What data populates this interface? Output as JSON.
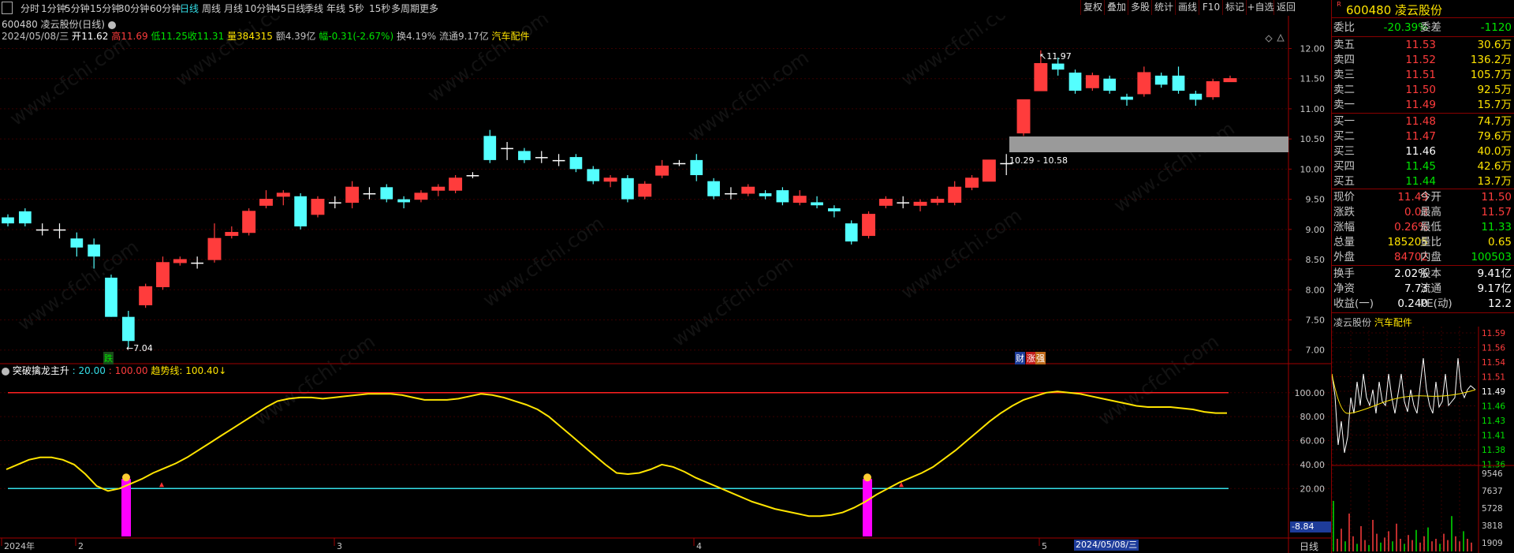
{
  "periods": [
    "分时",
    "1分钟",
    "5分钟",
    "15分钟",
    "30分钟",
    "60分钟",
    "日线",
    "周线",
    "月线",
    "10分钟",
    "45日线",
    "季线",
    "年线",
    "5秒",
    "15秒",
    "多周期",
    "更多"
  ],
  "active_period": "日线",
  "tools": [
    "复权",
    "叠加",
    "多股",
    "统计",
    "画线",
    "F10",
    "标记",
    "+自选",
    "返回"
  ],
  "chart_title": "600480 凌云股份(日线)",
  "info": {
    "date": "2024/05/08/三",
    "open_label": "开",
    "open": "11.62",
    "high_label": "高",
    "high": "11.69",
    "low_label": "低",
    "low": "11.25",
    "close_label": "收",
    "close": "11.31",
    "vol_label": "量",
    "vol": "384315",
    "amt_label": "额",
    "amt": "4.39亿",
    "chg_label": "幅",
    "chg": "-0.31(-2.67%)",
    "turn_label": "换",
    "turn": "4.19%",
    "float_label": "流通",
    "float": "9.17亿",
    "sector": "汽车配件"
  },
  "price_axis": [
    "12.00",
    "11.50",
    "11.00",
    "10.50",
    "10.00",
    "9.50",
    "9.00",
    "8.50",
    "8.00",
    "7.50",
    "7.00"
  ],
  "annotations": {
    "high_mark": "11.97",
    "low_mark": "7.04",
    "range_box": "10.29 - 10.58",
    "mark_die": "跌",
    "mark_cai": "财",
    "mark_zhang": "涨",
    "mark_qiang": "强"
  },
  "indicator": {
    "name": "突破擒龙主升",
    "p1": "20.00",
    "p2": "100.00",
    "trend_label": "趋势线:",
    "trend_val": "100.40↓",
    "axis": [
      "100.00",
      "80.00",
      "60.00",
      "40.00",
      "20.00"
    ],
    "cursor_val": "-8.84"
  },
  "date_axis": [
    "2024年",
    "2",
    "3",
    "4",
    "5"
  ],
  "cursor_date": "2024/05/08/三",
  "axis_corner": "日线",
  "panel": {
    "code": "600480",
    "name": "凌云股份",
    "badge": "R",
    "weibi_label": "委比",
    "weibi": "-20.39%",
    "weicha_label": "委差",
    "weicha": "-1120",
    "asks": [
      {
        "label": "卖五",
        "price": "11.53",
        "vol": "30.6万"
      },
      {
        "label": "卖四",
        "price": "11.52",
        "vol": "136.2万"
      },
      {
        "label": "卖三",
        "price": "11.51",
        "vol": "105.7万"
      },
      {
        "label": "卖二",
        "price": "11.50",
        "vol": "92.5万"
      },
      {
        "label": "卖一",
        "price": "11.49",
        "vol": "15.7万"
      }
    ],
    "bids": [
      {
        "label": "买一",
        "price": "11.48",
        "vol": "74.7万"
      },
      {
        "label": "买二",
        "price": "11.47",
        "vol": "79.6万"
      },
      {
        "label": "买三",
        "price": "11.46",
        "vol": "40.0万"
      },
      {
        "label": "买四",
        "price": "11.45",
        "vol": "42.6万"
      },
      {
        "label": "买五",
        "price": "11.44",
        "vol": "13.7万"
      }
    ],
    "stats": [
      {
        "l1": "现价",
        "v1": "11.49",
        "l2": "今开",
        "v2": "11.50"
      },
      {
        "l1": "涨跌",
        "v1": "0.03",
        "l2": "最高",
        "v2": "11.57"
      },
      {
        "l1": "涨幅",
        "v1": "0.26%",
        "l2": "最低",
        "v2": "11.33"
      },
      {
        "l1": "总量",
        "v1": "185205",
        "l2": "量比",
        "v2": "0.65"
      },
      {
        "l1": "外盘",
        "v1": "84702",
        "l2": "内盘",
        "v2": "100503"
      }
    ],
    "stats2": [
      {
        "l1": "换手",
        "v1": "2.02%",
        "l2": "股本",
        "v2": "9.41亿"
      },
      {
        "l1": "净资",
        "v1": "7.73",
        "l2": "流通",
        "v2": "9.17亿"
      },
      {
        "l1": "收益(一)",
        "v1": "0.240",
        "l2": "PE(动)",
        "v2": "12.2"
      }
    ],
    "mini_title": "凌云股份",
    "mini_sector": "汽车配件",
    "mini_axis": [
      "11.59",
      "11.56",
      "11.54",
      "11.51",
      "11.49",
      "11.46",
      "11.43",
      "11.41",
      "11.38",
      "11.36"
    ],
    "mini_vol_axis": [
      "9546",
      "7637",
      "5728",
      "3818",
      "1909"
    ]
  },
  "watermark": "www.cfchi.com",
  "chart_data": [
    {
      "type": "candlestick",
      "title": "600480 凌云股份(日线)",
      "ylim": [
        6.8,
        12.15
      ],
      "candles": [
        [
          9.2,
          9.1,
          9.25,
          9.05
        ],
        [
          9.3,
          9.1,
          9.35,
          9.05
        ],
        [
          9.0,
          9.0,
          9.1,
          8.9
        ],
        [
          9.0,
          9.0,
          9.1,
          8.85
        ],
        [
          8.85,
          8.7,
          8.95,
          8.55
        ],
        [
          8.75,
          8.55,
          8.85,
          8.35
        ],
        [
          8.2,
          7.55,
          8.25,
          7.55
        ],
        [
          7.55,
          7.15,
          7.65,
          7.04
        ],
        [
          7.75,
          8.05,
          8.1,
          7.7
        ],
        [
          8.05,
          8.45,
          8.55,
          8.0
        ],
        [
          8.45,
          8.5,
          8.55,
          8.4
        ],
        [
          8.45,
          8.45,
          8.55,
          8.35
        ],
        [
          8.5,
          8.85,
          9.1,
          8.45
        ],
        [
          8.9,
          8.95,
          9.05,
          8.85
        ],
        [
          8.95,
          9.3,
          9.35,
          8.9
        ],
        [
          9.4,
          9.5,
          9.65,
          9.35
        ],
        [
          9.55,
          9.6,
          9.65,
          9.4
        ],
        [
          9.55,
          9.05,
          9.6,
          9.0
        ],
        [
          9.25,
          9.5,
          9.55,
          9.2
        ],
        [
          9.45,
          9.45,
          9.55,
          9.35
        ],
        [
          9.45,
          9.7,
          9.8,
          9.35
        ],
        [
          9.6,
          9.6,
          9.7,
          9.5
        ],
        [
          9.7,
          9.5,
          9.75,
          9.45
        ],
        [
          9.5,
          9.45,
          9.55,
          9.35
        ],
        [
          9.5,
          9.6,
          9.65,
          9.45
        ],
        [
          9.65,
          9.7,
          9.75,
          9.55
        ],
        [
          9.65,
          9.85,
          9.9,
          9.6
        ],
        [
          9.9,
          9.9,
          9.95,
          9.85
        ],
        [
          10.55,
          10.15,
          10.65,
          10.1
        ],
        [
          10.35,
          10.35,
          10.45,
          10.15
        ],
        [
          10.3,
          10.15,
          10.35,
          10.1
        ],
        [
          10.2,
          10.2,
          10.3,
          10.1
        ],
        [
          10.15,
          10.15,
          10.25,
          10.05
        ],
        [
          10.2,
          10.0,
          10.25,
          9.95
        ],
        [
          10.0,
          9.8,
          10.05,
          9.75
        ],
        [
          9.8,
          9.85,
          9.9,
          9.7
        ],
        [
          9.85,
          9.5,
          9.9,
          9.45
        ],
        [
          9.55,
          9.75,
          9.8,
          9.5
        ],
        [
          9.9,
          10.05,
          10.15,
          9.85
        ],
        [
          10.1,
          10.1,
          10.15,
          10.05
        ],
        [
          10.15,
          9.9,
          10.25,
          9.8
        ],
        [
          9.8,
          9.55,
          9.85,
          9.5
        ],
        [
          9.6,
          9.6,
          9.7,
          9.5
        ],
        [
          9.6,
          9.7,
          9.75,
          9.55
        ],
        [
          9.6,
          9.55,
          9.65,
          9.5
        ],
        [
          9.65,
          9.45,
          9.7,
          9.4
        ],
        [
          9.45,
          9.55,
          9.65,
          9.4
        ],
        [
          9.45,
          9.4,
          9.55,
          9.35
        ],
        [
          9.35,
          9.3,
          9.4,
          9.2
        ],
        [
          9.1,
          8.8,
          9.15,
          8.75
        ],
        [
          8.9,
          9.25,
          9.3,
          8.85
        ],
        [
          9.4,
          9.5,
          9.55,
          9.35
        ],
        [
          9.45,
          9.45,
          9.55,
          9.35
        ],
        [
          9.4,
          9.45,
          9.5,
          9.3
        ],
        [
          9.45,
          9.5,
          9.55,
          9.4
        ],
        [
          9.45,
          9.7,
          9.8,
          9.4
        ],
        [
          9.7,
          9.85,
          9.9,
          9.65
        ],
        [
          9.8,
          10.15,
          10.15,
          9.8
        ],
        [
          10.1,
          10.1,
          10.25,
          9.9
        ],
        [
          10.6,
          11.15,
          11.15,
          10.55
        ],
        [
          11.3,
          11.75,
          11.97,
          11.3
        ],
        [
          11.75,
          11.65,
          11.85,
          11.55
        ],
        [
          11.6,
          11.3,
          11.65,
          11.25
        ],
        [
          11.35,
          11.55,
          11.6,
          11.3
        ],
        [
          11.5,
          11.3,
          11.55,
          11.25
        ],
        [
          11.2,
          11.15,
          11.25,
          11.05
        ],
        [
          11.25,
          11.6,
          11.7,
          11.2
        ],
        [
          11.55,
          11.4,
          11.6,
          11.35
        ],
        [
          11.55,
          11.3,
          11.7,
          11.25
        ],
        [
          11.25,
          11.15,
          11.3,
          11.05
        ],
        [
          11.2,
          11.45,
          11.5,
          11.15
        ],
        [
          11.45,
          11.5,
          11.55,
          11.45
        ]
      ]
    },
    {
      "type": "line",
      "title": "突破擒龙主升",
      "ylim": [
        -20,
        115
      ],
      "series": [
        {
          "name": "趋势线",
          "values": [
            36,
            40,
            44,
            46,
            46,
            44,
            40,
            32,
            22,
            18,
            20,
            24,
            28,
            33,
            37,
            41,
            46,
            52,
            58,
            64,
            70,
            76,
            82,
            88,
            93,
            95,
            96,
            96,
            95,
            96,
            97,
            98,
            99,
            99,
            99,
            98,
            96,
            94,
            94,
            94,
            95,
            97,
            99,
            98,
            96,
            93,
            90,
            86,
            80,
            72,
            64,
            56,
            48,
            40,
            33,
            32,
            33,
            36,
            40,
            38,
            34,
            29,
            25,
            21,
            17,
            13,
            9,
            6,
            3,
            1,
            -1,
            -3,
            -3,
            -2,
            0,
            4,
            9,
            15,
            20,
            25,
            29,
            33,
            38,
            45,
            52,
            60,
            68,
            76,
            83,
            89,
            94,
            97,
            100,
            101,
            100,
            99,
            97,
            95,
            93,
            91,
            89,
            88,
            88,
            88,
            87,
            86,
            84,
            83,
            83
          ]
        }
      ],
      "reference_lines": [
        100,
        20
      ]
    }
  ]
}
